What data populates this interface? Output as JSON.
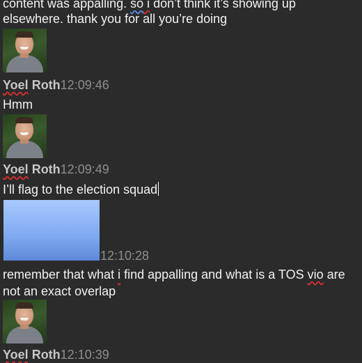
{
  "messages": {
    "top_line_1_a": "content was appalling. ",
    "top_line_1_so": "so",
    "top_line_1_i": " i",
    "top_line_1_b": " don’t think it’s showing up",
    "top_line_2": "elsewhere. thank you for all you’re doing",
    "hmm": "Hmm",
    "flag_text": "I’ll flag to the election squad",
    "remember_line_1_a": "remember that what ",
    "remember_line_1_i": "i",
    "remember_line_1_b": " find appalling and what is a TOS ",
    "remember_line_1_vio": "vio",
    "remember_line_1_c": " are",
    "remember_line_2": "not an exact overlap"
  },
  "headers": [
    {
      "first": "Yoel",
      "last": " Roth",
      "time": "12:09:46"
    },
    {
      "first": "Yoel",
      "last": " Roth",
      "time": "12:09:49"
    },
    {
      "first": "Yoel",
      "last": " Roth",
      "time": "12:10:39"
    }
  ],
  "other_user_time": "12:10:28",
  "colors": {
    "background": "#2b2b2b",
    "text": "#f2f2f2",
    "timestamp": "#8e8e8e",
    "name": "#c7c7c7",
    "other_avatar": "#7fa9f0"
  }
}
